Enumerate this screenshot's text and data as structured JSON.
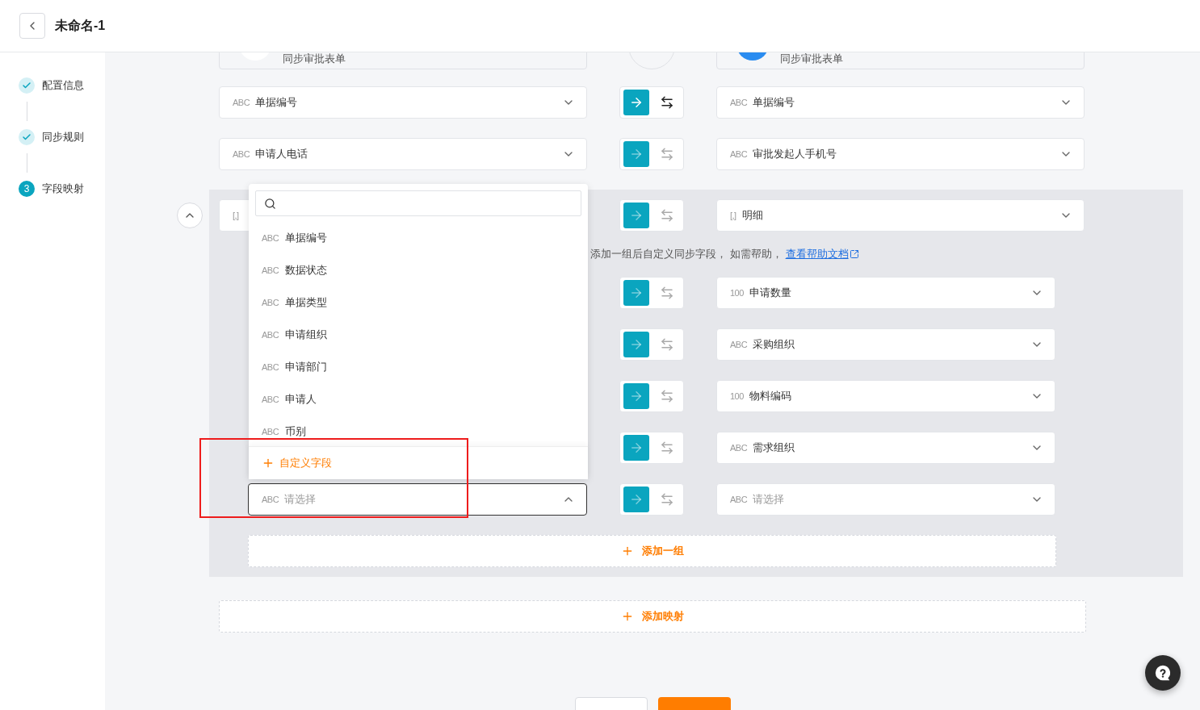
{
  "header": {
    "title": "未命名-1"
  },
  "steps": [
    {
      "label": "配置信息",
      "completed": true
    },
    {
      "label": "同步规则",
      "completed": true
    },
    {
      "label": "字段映射",
      "completed": false,
      "number": "3"
    }
  ],
  "source_app": {
    "title": "同步审批表单"
  },
  "target_app": {
    "title": "同步审批表单"
  },
  "mappings": [
    {
      "source": {
        "type_label": "ABC",
        "value": "单据编号"
      },
      "enabled": true,
      "target": {
        "type_label": "ABC",
        "value": "单据编号"
      }
    },
    {
      "source": {
        "type_label": "ABC",
        "value": "申请人电话"
      },
      "enabled": false,
      "target": {
        "type_label": "ABC",
        "value": "审批发起人手机号"
      }
    }
  ],
  "group": {
    "expanded": true,
    "header": {
      "source": {
        "type_label": "[,]"
      },
      "enabled": false,
      "target": {
        "type_label": "[,]",
        "value": "明细"
      }
    },
    "hint": "添加一组后自定义同步字段， 如需帮助，",
    "help_link": "查看帮助文档",
    "rows": [
      {
        "enabled": false,
        "target": {
          "type_label": "100",
          "value": "申请数量"
        }
      },
      {
        "enabled": false,
        "target": {
          "type_label": "ABC",
          "value": "采购组织"
        }
      },
      {
        "enabled": false,
        "target": {
          "type_label": "100",
          "value": "物料编码"
        }
      },
      {
        "enabled": false,
        "target": {
          "type_label": "ABC",
          "value": "需求组织"
        }
      },
      {
        "source": {
          "type_label": "ABC",
          "placeholder": "请选择",
          "open": true
        },
        "enabled": false,
        "target": {
          "type_label": "ABC",
          "placeholder": "请选择"
        }
      }
    ],
    "add_button": "添加一组"
  },
  "dropdown": {
    "items": [
      {
        "type_label": "ABC",
        "label": "单据编号"
      },
      {
        "type_label": "ABC",
        "label": "数据状态"
      },
      {
        "type_label": "ABC",
        "label": "单据类型"
      },
      {
        "type_label": "ABC",
        "label": "申请组织"
      },
      {
        "type_label": "ABC",
        "label": "申请部门"
      },
      {
        "type_label": "ABC",
        "label": "申请人"
      },
      {
        "type_label": "ABC",
        "label": "币别"
      }
    ],
    "footer": "自定义字段"
  },
  "add_mapping": "添加映射"
}
